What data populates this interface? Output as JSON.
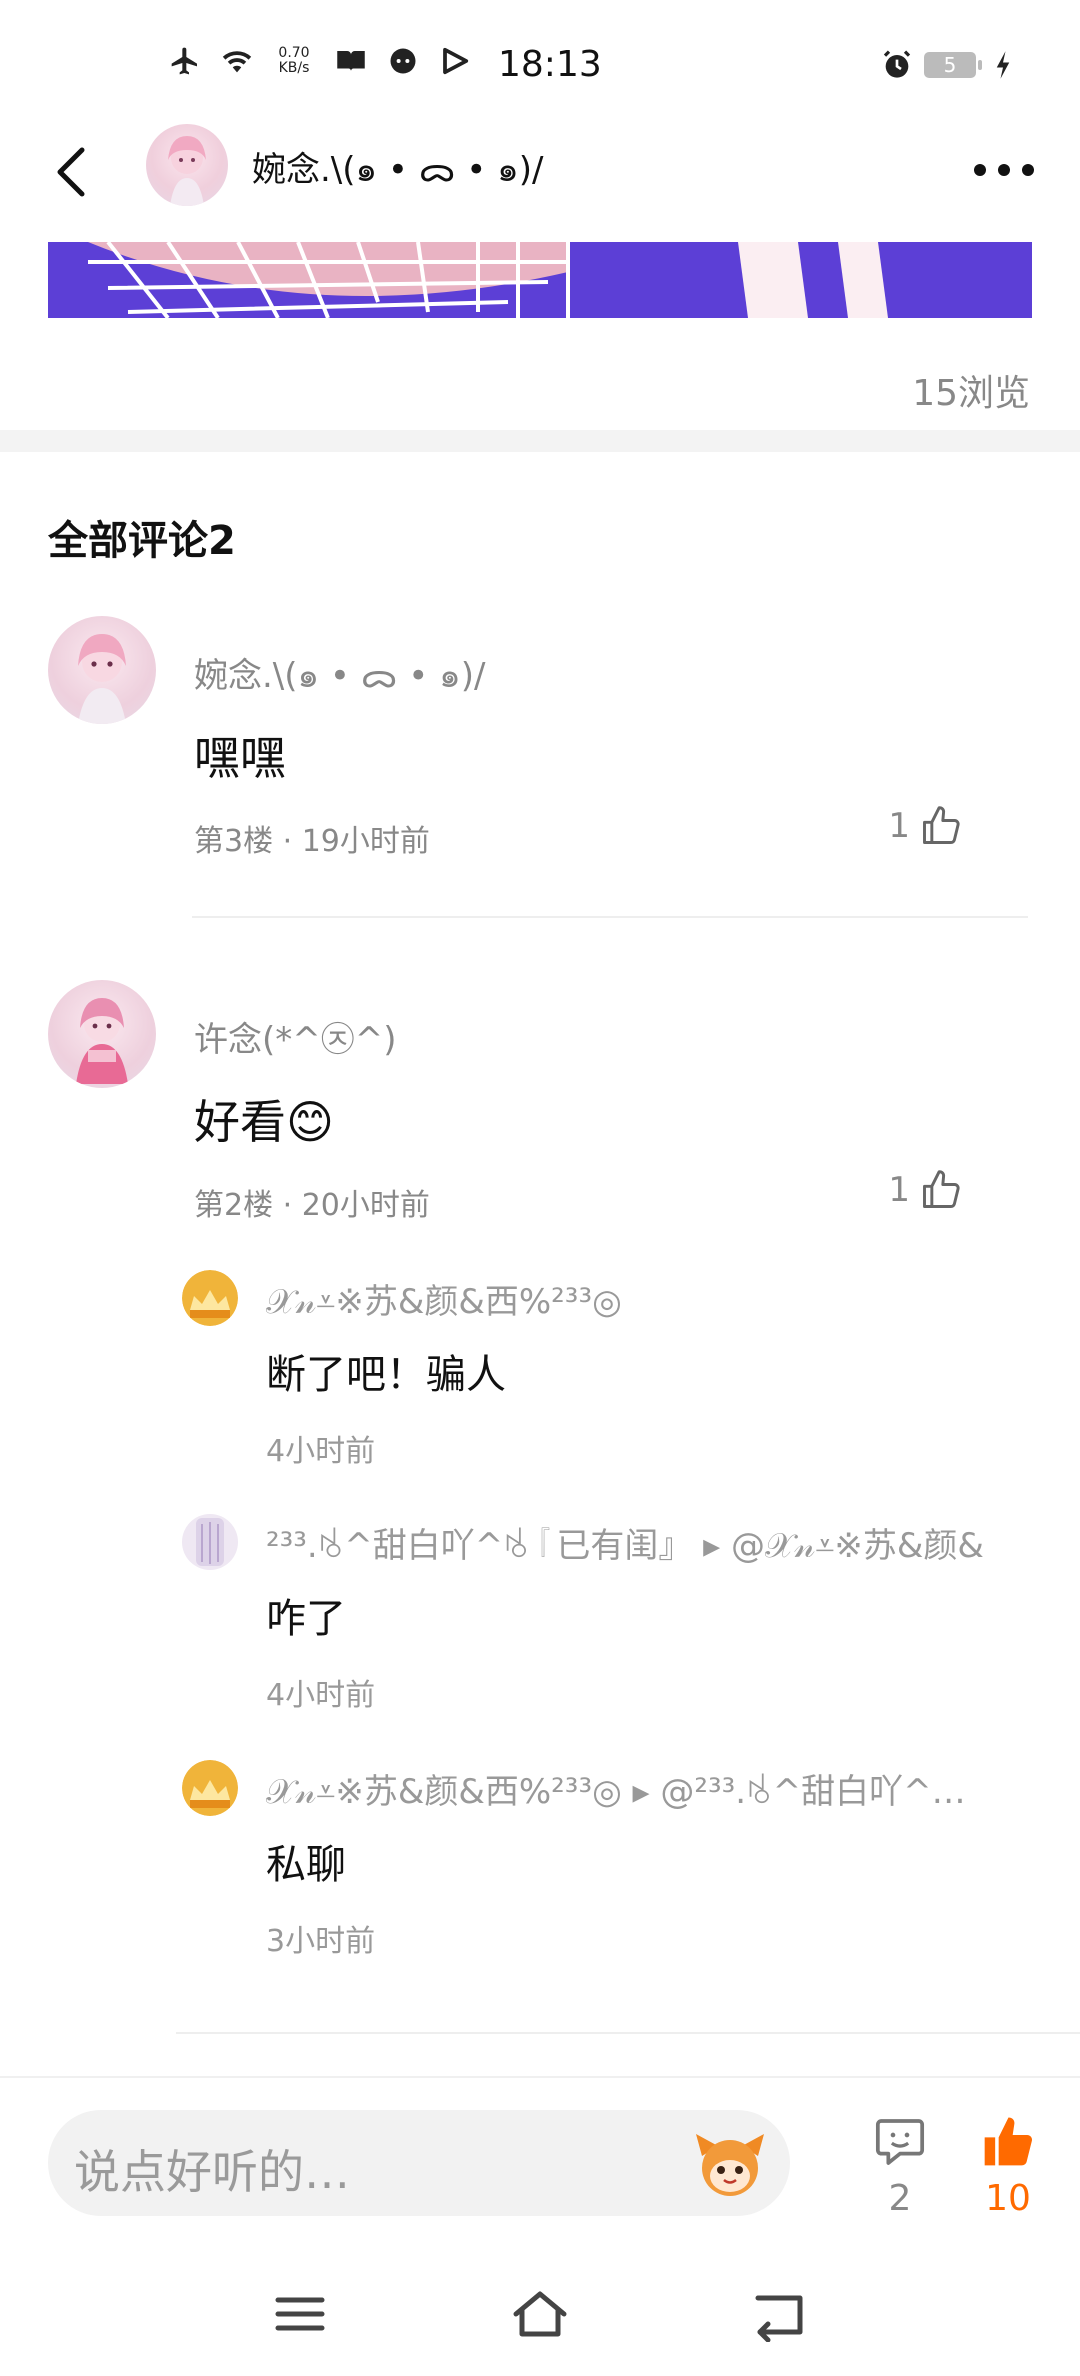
{
  "status_bar": {
    "speed_value": "0.70",
    "speed_unit": "KB/s",
    "time": "18:13",
    "battery": "5"
  },
  "header": {
    "title": "婉念.\\(๑ • ᯅ • ๑)/"
  },
  "post": {
    "views": "15浏览"
  },
  "comments_section": {
    "title": "全部评论2"
  },
  "comments": [
    {
      "name": "婉念.\\(๑ • ᯅ • ๑)/",
      "text": "嘿嘿",
      "meta": "第3楼 · 19小时前",
      "likes": "1"
    },
    {
      "name": "许念(*^㉨^)",
      "text": "好看😊",
      "meta": "第2楼 · 20小时前",
      "likes": "1",
      "replies": [
        {
          "name": "𝒳𝓃⩡※苏&颜&西%²³³◎",
          "text": "断了吧！骗人",
          "time": "4小时前"
        },
        {
          "name": "²³³.ꂚ^甜白吖^ꂚ『已有闺』 ▸ @𝒳𝓃⩡※苏&颜&",
          "text": "咋了",
          "time": "4小时前"
        },
        {
          "name": "𝒳𝓃⩡※苏&颜&西%²³³◎ ▸ @²³³.ꂚ^甜白吖^…",
          "text": "私聊",
          "time": "3小时前"
        }
      ]
    }
  ],
  "bottom_bar": {
    "input_placeholder": "说点好听的…",
    "comment_count": "2",
    "like_count": "10"
  },
  "colors": {
    "accent": "#ff6a00",
    "post_image_bg": "#5c3fd6",
    "muted_text": "#888888"
  },
  "icons": {
    "status_left": [
      "airplane-icon",
      "wifi-icon",
      "book-icon",
      "face-icon",
      "play-icon"
    ],
    "status_right": [
      "alarm-icon",
      "battery-icon",
      "charging-icon"
    ]
  }
}
